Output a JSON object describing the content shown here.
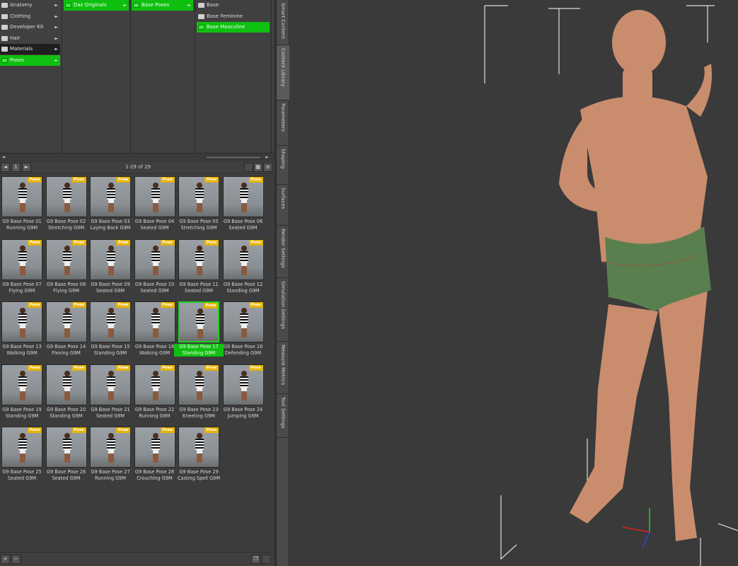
{
  "browser": {
    "col1": [
      {
        "label": "Anatomy",
        "state": "normal"
      },
      {
        "label": "Clothing",
        "state": "normal"
      },
      {
        "label": "Developer Kit",
        "state": "normal"
      },
      {
        "label": "Hair",
        "state": "normal"
      },
      {
        "label": "Materials",
        "state": "selected"
      },
      {
        "label": "Poses",
        "state": "green"
      }
    ],
    "col2": [
      {
        "label": "Daz Originals",
        "state": "green"
      }
    ],
    "col3": [
      {
        "label": "Base Poses",
        "state": "green"
      }
    ],
    "col4": [
      {
        "label": "Base",
        "state": "normal"
      },
      {
        "label": "Base Feminine",
        "state": "normal"
      },
      {
        "label": "Base Masculine",
        "state": "green"
      }
    ]
  },
  "navbar": {
    "prev": "◄",
    "page": "1",
    "next": "►",
    "count": "1-29 of 29"
  },
  "badge_text": "Pose",
  "poses": [
    [
      "G9 Base Pose 01",
      "Running G9M"
    ],
    [
      "G9 Base Pose 02",
      "Stretching G9M"
    ],
    [
      "G9 Base Pose 03",
      "Laying Back G9M"
    ],
    [
      "G9 Base Pose 04",
      "Seated G9M"
    ],
    [
      "G9 Base Pose 05",
      "Stretching G9M"
    ],
    [
      "G9 Base Pose 06",
      "Seated G9M"
    ],
    [
      "G9 Base Pose 07",
      "Flying G9M"
    ],
    [
      "G9 Base Pose 08",
      "Flying G9M"
    ],
    [
      "G9 Base Pose 09",
      "Seated G9M"
    ],
    [
      "G9 Base Pose 10",
      "Seated G9M"
    ],
    [
      "G9 Base Pose 11",
      "Seated G9M"
    ],
    [
      "G9 Base Pose 12",
      "Standing G9M"
    ],
    [
      "G9 Base Pose 13",
      "Walking G9M"
    ],
    [
      "G9 Base Pose 14",
      "Flexing G9M"
    ],
    [
      "G9 Base Pose 15",
      "Standing G9M"
    ],
    [
      "G9 Base Pose 16",
      "Walking G9M"
    ],
    [
      "G9 Base Pose 17",
      "Standing G9M"
    ],
    [
      "G9 Base Pose 18",
      "Defending G9M"
    ],
    [
      "G9 Base Pose 19",
      "Standing G9M"
    ],
    [
      "G9 Base Pose 20",
      "Standing G9M"
    ],
    [
      "G9 Base Pose 21",
      "Seated G9M"
    ],
    [
      "G9 Base Pose 22",
      "Running G9M"
    ],
    [
      "G9 Base Pose 23",
      "Kneeling G9M"
    ],
    [
      "G9 Base Pose 24",
      "Jumping G9M"
    ],
    [
      "G9 Base Pose 25",
      "Seated G9M"
    ],
    [
      "G9 Base Pose 26",
      "Seated G9M"
    ],
    [
      "G9 Base Pose 27",
      "Running G9M"
    ],
    [
      "G9 Base Pose 28",
      "Crouching G9M"
    ],
    [
      "G9 Base Pose 29",
      "Casting Spell G9M"
    ]
  ],
  "selected_pose_index": 16,
  "bottombar": {
    "add": "+",
    "remove": "−"
  },
  "tabs": [
    {
      "label": "Smart Content",
      "active": false
    },
    {
      "label": "Content Library",
      "active": true
    },
    {
      "label": "Parameters",
      "active": false
    },
    {
      "label": "Shaping",
      "active": false
    },
    {
      "label": "Surfaces",
      "active": false
    },
    {
      "label": "Render Settings",
      "active": false
    },
    {
      "label": "Simulation Settings",
      "active": false
    },
    {
      "label": "Measure Metrics",
      "active": false
    },
    {
      "label": "Tool Settings",
      "active": false
    }
  ],
  "colors": {
    "accent_green": "#10c010",
    "badge": "#e8b400",
    "viewport_bg": "#3a3a3a",
    "shorts": "#5a7f4f",
    "skin": "#c98d6d"
  }
}
